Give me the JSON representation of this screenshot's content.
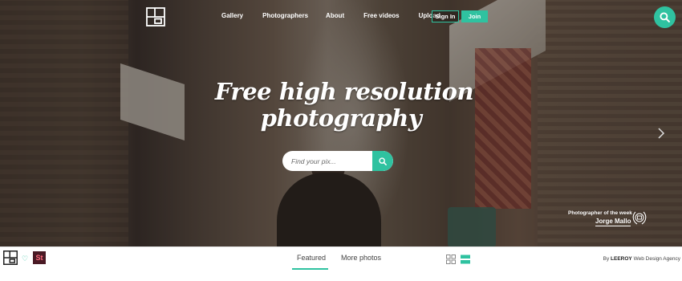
{
  "nav": {
    "items": [
      "Gallery",
      "Photographers",
      "About",
      "Free videos",
      "Upload"
    ],
    "signin": "Sign In",
    "join": "Join"
  },
  "hero": {
    "title_line1": "Free high resolution",
    "title_line2": "photography",
    "search_placeholder": "Find your pix...",
    "potw_label": "Photographer of the week",
    "potw_name": "Jorge Mallo"
  },
  "bottom": {
    "tabs": [
      "Featured",
      "More photos"
    ],
    "active_tab": "Featured",
    "st_badge": "St",
    "credit_prefix": "By",
    "credit_brand": "LEEROY",
    "credit_suffix": "Web Design Agency"
  },
  "colors": {
    "accent": "#2fc2a0",
    "white": "#ffffff",
    "bottom_bg": "#ffffff"
  },
  "icons": [
    "logo-icon",
    "search-icon",
    "chevron-right-icon",
    "laurel-icon",
    "heart-icon",
    "grid-view-icon",
    "list-view-icon"
  ]
}
